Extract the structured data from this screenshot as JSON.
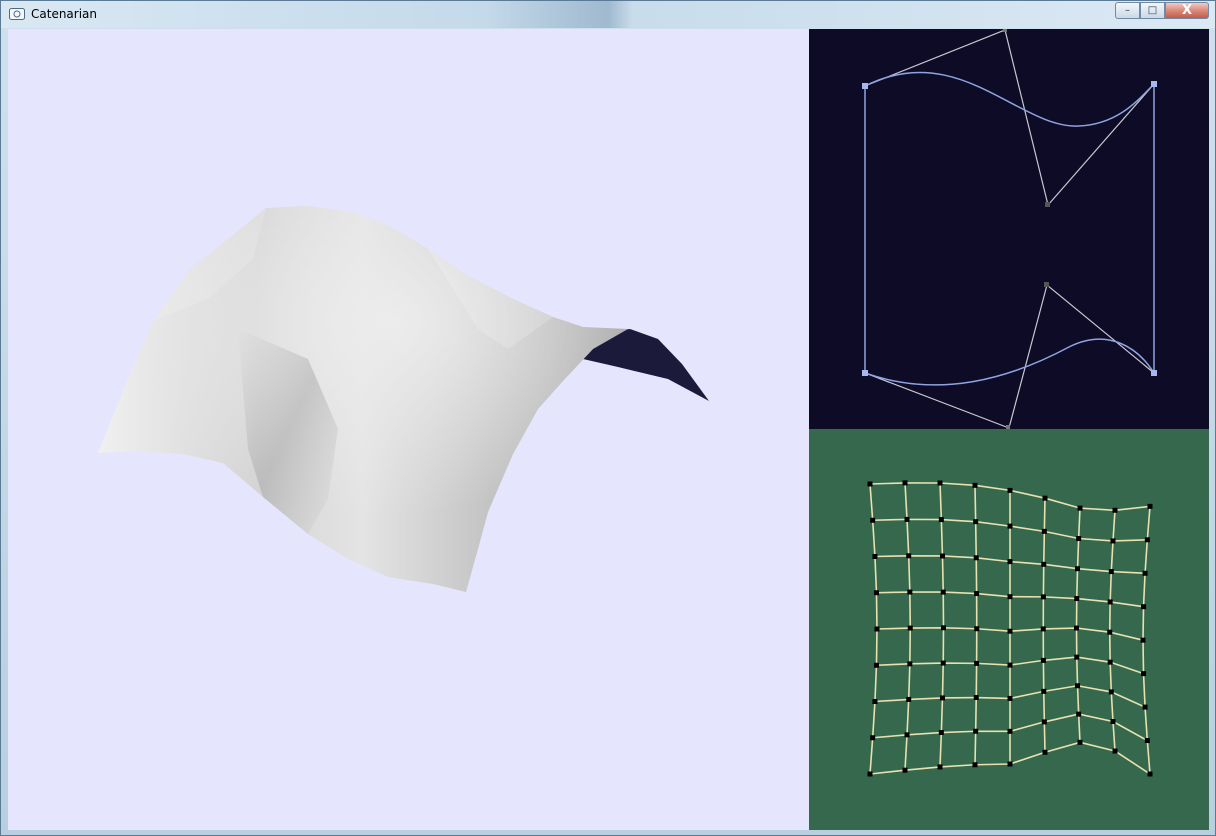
{
  "window": {
    "title": "Catenarian",
    "buttons": {
      "minimize": "–",
      "maximize": "□",
      "close": "X"
    }
  },
  "colors": {
    "viewport_background": "#e5e5fd",
    "curve_panel_background": "#0e0b27",
    "grid_panel_background": "#35684c",
    "curve_color": "#8fa3e0",
    "control_line_color": "#c8c8d0",
    "grid_line_color": "#e8e2b0",
    "grid_node_color": "#000000"
  },
  "icons": {
    "app": "window-app-icon"
  }
}
